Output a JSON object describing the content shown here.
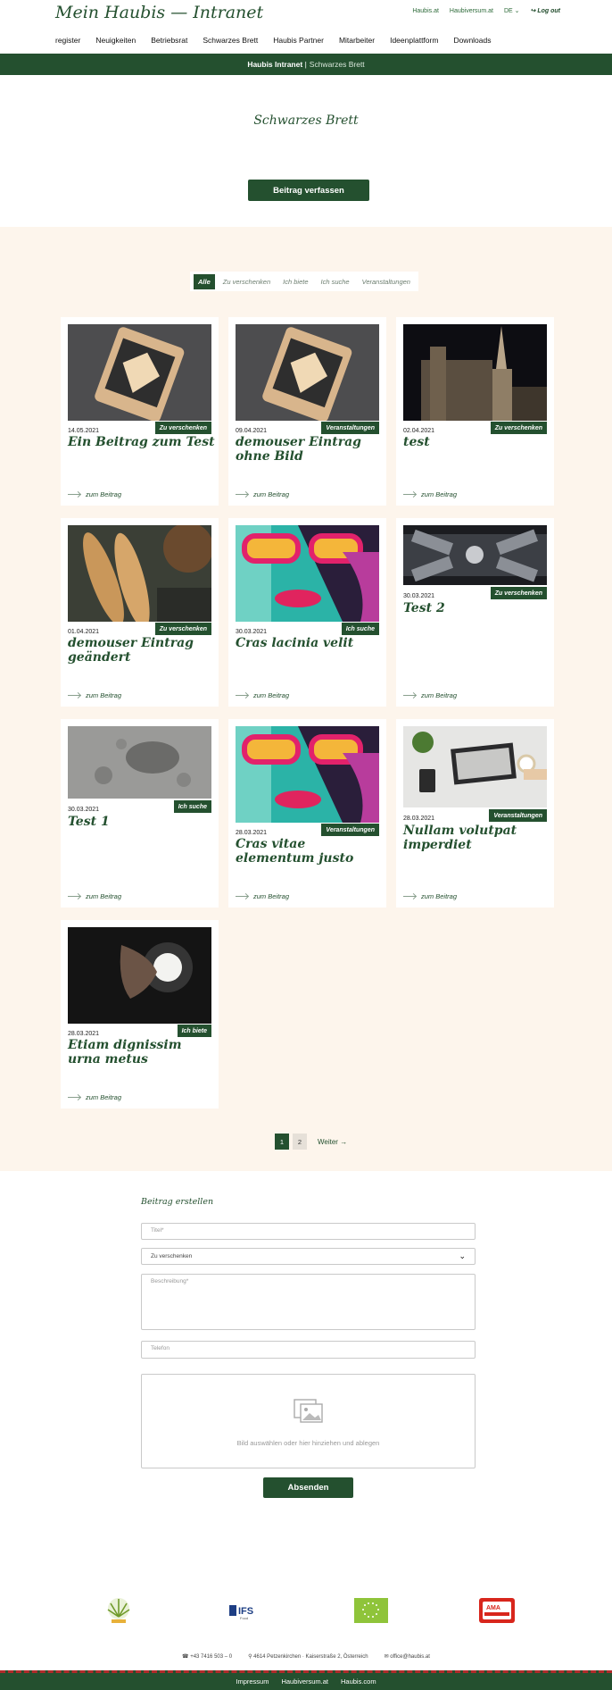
{
  "header": {
    "logo": "Mein Haubis — Intranet",
    "toplinks": [
      "Haubis.at",
      "Haubiversum.at"
    ],
    "lang": "DE",
    "logout": "Log out",
    "nav": [
      "register",
      "Neuigkeiten",
      "Betriebsrat",
      "Schwarzes Brett",
      "Haubis Partner",
      "Mitarbeiter",
      "Ideenplattform",
      "Downloads"
    ]
  },
  "breadcrumb": {
    "root": "Haubis Intranet",
    "sep": "|",
    "current": "Schwarzes Brett"
  },
  "hero": {
    "title": "Schwarzes Brett",
    "button": "Beitrag verfassen"
  },
  "filters": [
    "Alle",
    "Zu verschenken",
    "Ich biete",
    "Ich suche",
    "Veranstaltungen"
  ],
  "cards": [
    {
      "date": "14.05.2021",
      "badge": "Zu verschenken",
      "title": "Ein Beitrag zum Test",
      "more": "zum Beitrag",
      "image": "tablet"
    },
    {
      "date": "09.04.2021",
      "badge": "Veranstaltungen",
      "title": "demouser Eintrag ohne Bild",
      "more": "zum Beitrag",
      "image": "tablet"
    },
    {
      "date": "02.04.2021",
      "badge": "Zu verschenken",
      "title": "test",
      "more": "zum Beitrag",
      "image": "cathedral"
    },
    {
      "date": "01.04.2021",
      "badge": "Zu verschenken",
      "title": "demouser Eintrag geändert",
      "more": "zum Beitrag",
      "image": "bread"
    },
    {
      "date": "30.03.2021",
      "badge": "Ich suche",
      "title": "Cras lacinia velit",
      "more": "zum Beitrag",
      "image": "graffiti"
    },
    {
      "date": "30.03.2021",
      "badge": "Zu verschenken",
      "title": "Test 2",
      "more": "zum Beitrag",
      "image": "space-station"
    },
    {
      "date": "30.03.2021",
      "badge": "Ich suche",
      "title": "Test 1",
      "more": "zum Beitrag",
      "image": "moon"
    },
    {
      "date": "28.03.2021",
      "badge": "Veranstaltungen",
      "title": "Cras vitae elementum justo",
      "more": "zum Beitrag",
      "image": "graffiti"
    },
    {
      "date": "28.03.2021",
      "badge": "Veranstaltungen",
      "title": "Nullam volutpat imperdiet",
      "more": "zum Beitrag",
      "image": "laptop"
    },
    {
      "date": "28.03.2021",
      "badge": "Ich biete",
      "title": "Etiam dignissim urna metus",
      "more": "zum Beitrag",
      "image": "hand-light"
    }
  ],
  "pagination": {
    "pages": [
      "1",
      "2"
    ],
    "next": "Weiter →"
  },
  "form": {
    "title": "Beitrag erstellen",
    "title_placeholder": "Titel*",
    "category_value": "Zu verschenken",
    "description_placeholder": "Beschreibung*",
    "phone_placeholder": "Telefon",
    "dropzone_text": "Bild auswählen oder hier hinziehen und ablegen",
    "submit": "Absenden"
  },
  "logos": [
    "Demeter",
    "IFS Food",
    "EU Bio",
    "AMA Gütesiegel"
  ],
  "contact": {
    "phone": "+43 7416 503 – 0",
    "address": "4614 Petzenkirchen · Kaiserstraße 2, Österreich",
    "email": "office@haubis.at"
  },
  "footer": [
    "Impressum",
    "Haubiversum.at",
    "Haubis.com"
  ],
  "colors": {
    "brand_green": "#24502f",
    "board_bg": "#fdf5ec",
    "footer_stripe": "#b12b2b"
  }
}
